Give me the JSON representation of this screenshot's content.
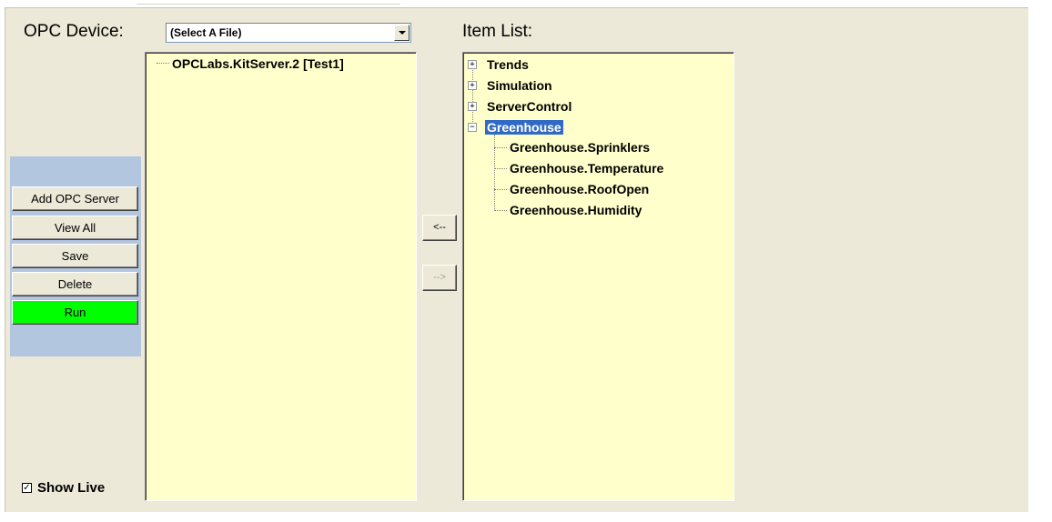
{
  "device": {
    "label": "OPC Device:",
    "select_value": "(Select A File)"
  },
  "item_list_label": "Item List:",
  "server_tree": {
    "items": [
      {
        "label": "OPCLabs.KitServer.2 [Test1]"
      }
    ]
  },
  "item_tree": {
    "nodes": [
      {
        "label": "Trends",
        "expander": "+"
      },
      {
        "label": "Simulation",
        "expander": "+"
      },
      {
        "label": "ServerControl",
        "expander": "+"
      },
      {
        "label": "Greenhouse",
        "expander": "−",
        "selected": true
      }
    ],
    "children": [
      {
        "label": "Greenhouse.Sprinklers"
      },
      {
        "label": "Greenhouse.Temperature"
      },
      {
        "label": "Greenhouse.RoofOpen"
      },
      {
        "label": "Greenhouse.Humidity"
      }
    ]
  },
  "buttons": {
    "add": "Add OPC Server",
    "view_all": "View All",
    "save": "Save",
    "delete": "Delete",
    "run": "Run",
    "move_left": "<--",
    "move_right": "-->"
  },
  "show_live": {
    "label": "Show Live",
    "checked": true,
    "check_glyph": "✓"
  },
  "colors": {
    "tree_bg": "#ffffcc",
    "selection": "#316ac5",
    "run_button": "#00ff00",
    "side_panel": "#b3c6e0"
  }
}
